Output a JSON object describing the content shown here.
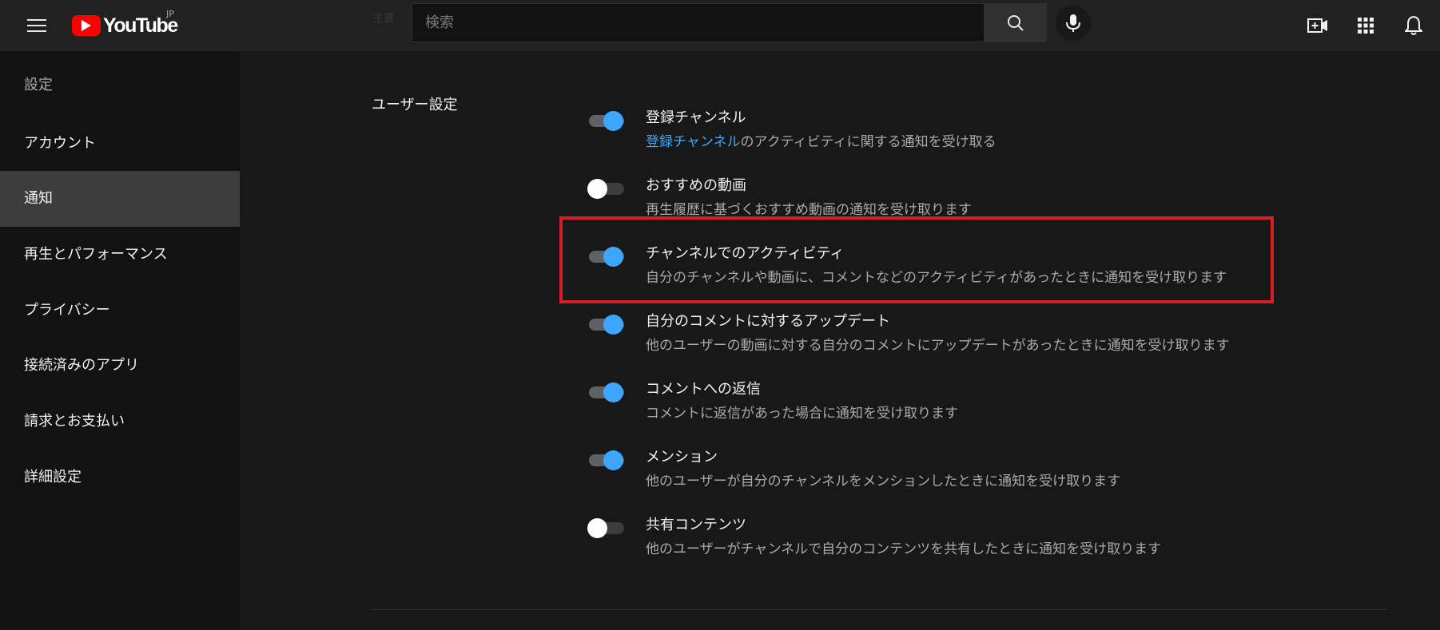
{
  "header": {
    "logo_text": "YouTube",
    "logo_country": "JP",
    "ghost_title": "主要",
    "search_placeholder": "検索"
  },
  "sidebar": {
    "title": "設定",
    "items": [
      {
        "label": "アカウント"
      },
      {
        "label": "通知"
      },
      {
        "label": "再生とパフォーマンス"
      },
      {
        "label": "プライバシー"
      },
      {
        "label": "接続済みのアプリ"
      },
      {
        "label": "請求とお支払い"
      },
      {
        "label": "詳細設定"
      }
    ],
    "active_index": 1
  },
  "main": {
    "section_label": "ユーザー設定",
    "settings": [
      {
        "title": "登録チャンネル",
        "desc_link": "登録チャンネル",
        "desc": "のアクティビティに関する通知を受け取る",
        "enabled": true
      },
      {
        "title": "おすすめの動画",
        "desc": "再生履歴に基づくおすすめ動画の通知を受け取ります",
        "enabled": false
      },
      {
        "title": "チャンネルでのアクティビティ",
        "desc": "自分のチャンネルや動画に、コメントなどのアクティビティがあったときに通知を受け取ります",
        "enabled": true
      },
      {
        "title": "自分のコメントに対するアップデート",
        "desc": "他のユーザーの動画に対する自分のコメントにアップデートがあったときに通知を受け取ります",
        "enabled": true
      },
      {
        "title": "コメントへの返信",
        "desc": "コメントに返信があった場合に通知を受け取ります",
        "enabled": true
      },
      {
        "title": "メンション",
        "desc": "他のユーザーが自分のチャンネルをメンションしたときに通知を受け取ります",
        "enabled": true
      },
      {
        "title": "共有コンテンツ",
        "desc": "他のユーザーがチャンネルで自分のコンテンツを共有したときに通知を受け取ります",
        "enabled": false
      }
    ],
    "highlighted_index": 2
  },
  "colors": {
    "accent": "#3ea6ff",
    "brand": "#ff0000",
    "highlight": "#d81e24"
  },
  "icons": [
    "menu-icon",
    "youtube-play-icon",
    "search-icon",
    "mic-icon",
    "create-video-icon",
    "apps-grid-icon",
    "bell-icon"
  ]
}
